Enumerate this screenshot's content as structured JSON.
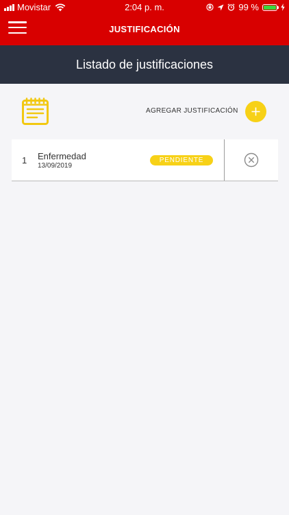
{
  "status_bar": {
    "carrier": "Movistar",
    "time": "2:04 p. m.",
    "battery": "99 %"
  },
  "nav": {
    "title": "JUSTIFICACIÓN"
  },
  "subheader": {
    "title": "Listado de justificaciones"
  },
  "toolbar": {
    "add_label": "AGREGAR JUSTIFICACIÓN"
  },
  "justifications": [
    {
      "index": "1",
      "title": "Enfermedad",
      "date": "13/09/2019",
      "status": "PENDIENTE"
    }
  ],
  "colors": {
    "brand_red": "#d80000",
    "header_navy": "#2b3241",
    "accent_yellow": "#f7d117"
  },
  "icons": {
    "menu": "hamburger-icon",
    "list": "notepad-icon",
    "add": "plus-icon",
    "delete": "close-circle-icon"
  }
}
